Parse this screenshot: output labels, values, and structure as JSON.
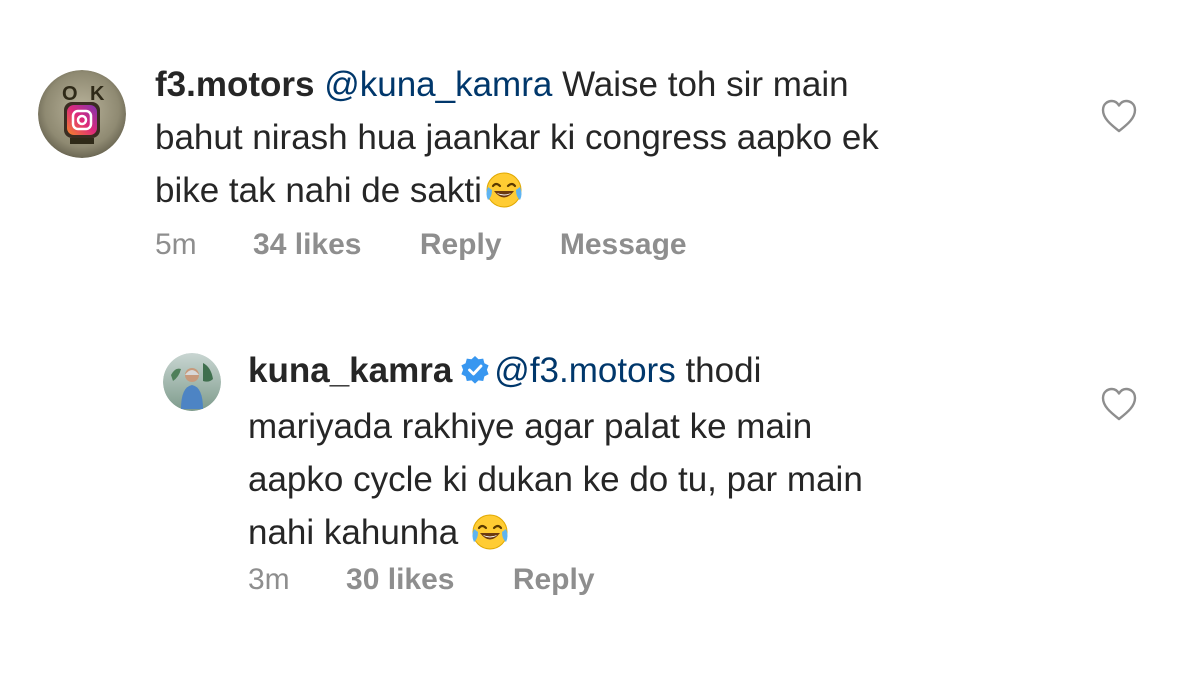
{
  "comments": [
    {
      "username": "f3.motors",
      "mention": "@kuna_kamra",
      "text_line1": " Waise toh sir main",
      "text_line2": "bahut nirash hua jaankar ki congress aapko ek",
      "text_line3": "bike tak nahi de sakti",
      "emoji": "face-with-tears-of-joy",
      "time": "5m",
      "likes": "34 likes",
      "reply_label": "Reply",
      "message_label": "Message"
    },
    {
      "username": "kuna_kamra",
      "verified": true,
      "mention": "@f3.motors",
      "text_line1": " thodi",
      "text_line2": "mariyada rakhiye agar palat ke main",
      "text_line3": "aapko cycle ki dukan ke do tu, par main",
      "text_line4": "nahi kahunha ",
      "emoji": "face-with-tears-of-joy",
      "time": "3m",
      "likes": "30 likes",
      "reply_label": "Reply"
    }
  ],
  "colors": {
    "text": "#262626",
    "mention": "#00376b",
    "meta": "#8e8e8e",
    "verified": "#3897f0"
  }
}
